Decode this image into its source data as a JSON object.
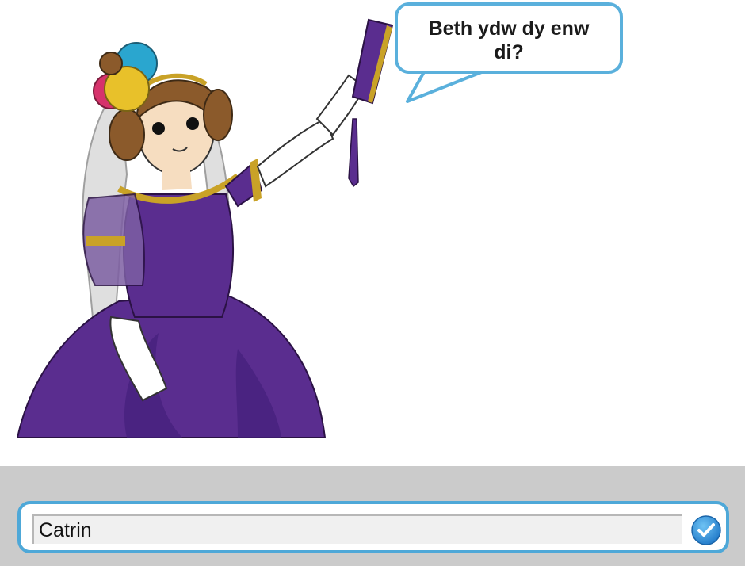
{
  "stage": {
    "speech_bubble": {
      "text": "Beth ydw dy enw di?"
    },
    "sprite": {
      "icon": "ada-lovelace-sprite",
      "colors": {
        "dress": "#5a2d8f",
        "dress_shadow": "#43207a",
        "trim": "#c9a227",
        "hair": "#8b5a2b",
        "skin": "#f6ddc0",
        "veil": "#9a9a9a",
        "flower_blue": "#2aa6cf",
        "flower_pink": "#d6336c",
        "flower_yellow": "#e8c12a"
      }
    }
  },
  "ask_panel": {
    "answer_input": {
      "value": "Catrin"
    },
    "submit_button": {
      "icon": "checkmark-icon"
    },
    "colors": {
      "panel_bg": "#cbcbcb",
      "border": "#4ea8d8",
      "button": "#2f8fd8"
    }
  }
}
